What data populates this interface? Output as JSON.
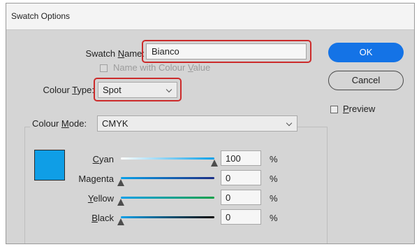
{
  "dialog": {
    "title": "Swatch Options"
  },
  "swatch_name": {
    "label_pre": "Swatch ",
    "label_key": "N",
    "label_post": "ame:",
    "value": "Bianco"
  },
  "name_with_colour_value": {
    "label_pre": "Name with Colour ",
    "label_key": "V",
    "label_post": "alue",
    "checked": false,
    "enabled": false
  },
  "colour_type": {
    "label_pre": "Colour ",
    "label_key": "T",
    "label_post": "ype:",
    "value": "Spot"
  },
  "colour_mode": {
    "label_pre": "Colour ",
    "label_key": "M",
    "label_post": "ode:",
    "value": "CMYK"
  },
  "buttons": {
    "ok": "OK",
    "cancel": "Cancel"
  },
  "preview": {
    "label_key": "P",
    "label_post": "review",
    "checked": false
  },
  "swatch_color": "#0f9ee6",
  "channels": [
    {
      "pre": "",
      "key": "C",
      "post": "yan",
      "value": "100",
      "level": 1.0
    },
    {
      "pre": "Ma",
      "key": "g",
      "post": "enta",
      "value": "0",
      "level": 0
    },
    {
      "pre": "",
      "key": "Y",
      "post": "ellow",
      "value": "0",
      "level": 0
    },
    {
      "pre": "",
      "key": "B",
      "post": "lack",
      "value": "0",
      "level": 0
    }
  ],
  "percent_sign": "%",
  "highlight_color": "#cc2b2b",
  "accent_color": "#1473e6"
}
